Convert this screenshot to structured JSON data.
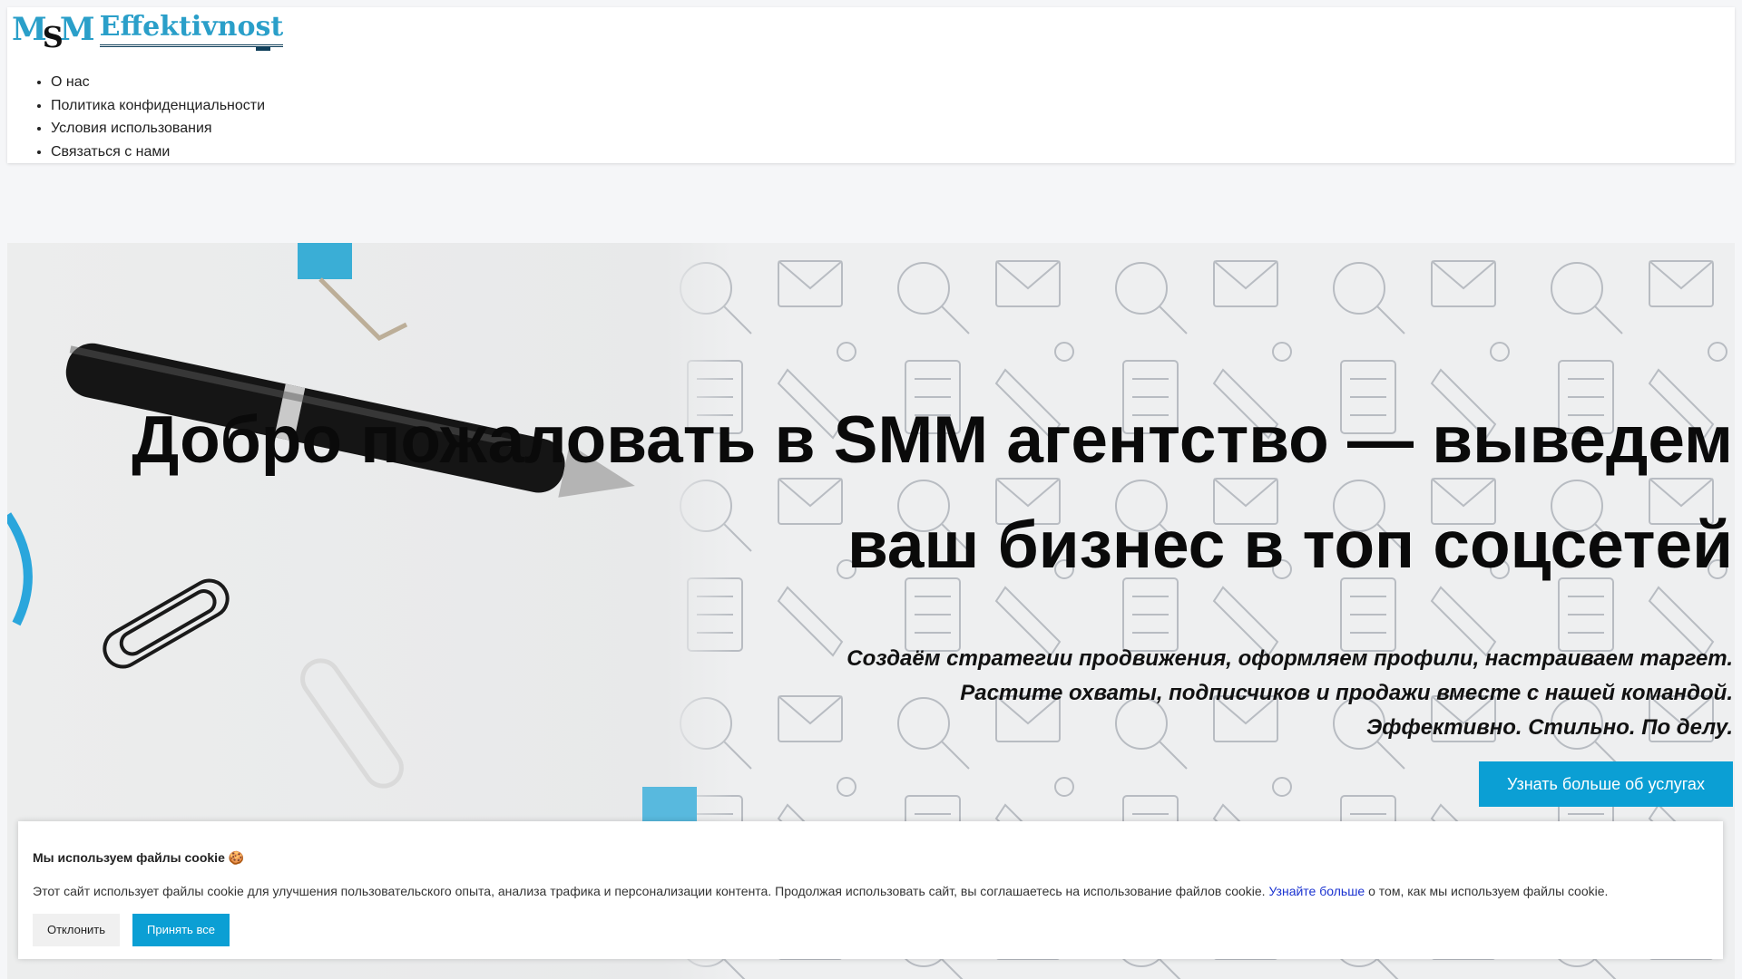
{
  "header": {
    "logo": {
      "m1": "M",
      "s": "S",
      "m2": "M",
      "word": "Effektivnost"
    },
    "nav": [
      {
        "label": "О нас"
      },
      {
        "label": "Политика конфиденциальности"
      },
      {
        "label": "Условия использования"
      },
      {
        "label": "Связаться с нами"
      }
    ]
  },
  "hero": {
    "title": "Добро пожаловать в SMM агентство — выведем ваш бизнес в топ соцсетей",
    "subtitle_lines": [
      "Создаём стратегии продвижения, оформляем профили, настраиваем таргет.",
      "Растите охваты, подписчиков и продажи вместе с нашей командой.",
      "Эффективно. Стильно. По делу."
    ],
    "cta_label": "Узнать больше об услугах"
  },
  "cookie_banner": {
    "title": "Мы используем файлы cookie 🍪",
    "text_before": "Этот сайт использует файлы cookie для улучшения пользовательского опыта, анализа трафика и персонализации контента. Продолжая использовать сайт, вы соглашаетесь на использование файлов cookie. ",
    "link_text": "Узнайте больше",
    "text_after": " о том, как мы используем файлы cookie.",
    "decline_label": "Отклонить",
    "accept_label": "Принять все"
  },
  "colors": {
    "accent": "#0b9fd4",
    "logo_blue": "#2a9fc9",
    "link": "#1a32d0"
  }
}
